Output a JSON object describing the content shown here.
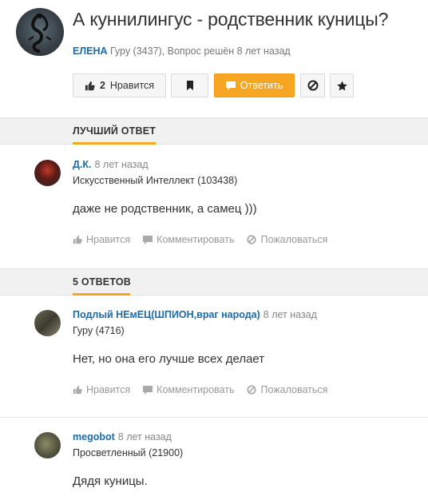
{
  "question": {
    "title": "А куннилингус - родственник куницы?",
    "author": "ЕЛЕНА",
    "meta": "Гуру (3437), Вопрос решён 8 лет назад",
    "like_count": "2",
    "like_label": "Нравится",
    "answer_label": "Ответить"
  },
  "best_answer": {
    "section_label": "ЛУЧШИЙ ОТВЕТ",
    "author": "Д.К.",
    "time": "8 лет назад",
    "rank": "Искусственный Интеллект (103438)",
    "text": "даже не родственник, а самец )))"
  },
  "answers_section": {
    "label": "5 ОТВЕТОВ"
  },
  "answers": [
    {
      "author": "Подлый НЕмЕЦ(ШПИОН,враг народа)",
      "time": "8 лет назад",
      "rank": "Гуру (4716)",
      "text": "Нет, но она его лучше всех делает"
    },
    {
      "author": "megobot",
      "time": "8 лет назад",
      "rank": "Просветленный (21900)",
      "text": "Дядя куницы."
    }
  ],
  "actions": {
    "like": "Нравится",
    "comment": "Комментировать",
    "report": "Пожаловаться"
  },
  "colors": {
    "accent": "#f6a623",
    "link": "#1e6aa8"
  }
}
